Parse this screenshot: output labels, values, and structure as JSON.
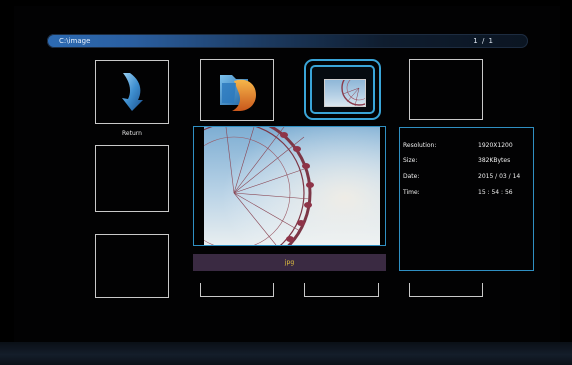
{
  "path_bar": {
    "path": "C:\\image",
    "page_indicator": "1 / 1"
  },
  "tiles": {
    "return_label": "Return",
    "folder_icon": "folder-icon",
    "return_icon": "return-arrow-icon",
    "selected_thumbnail": "ferris-wheel-thumbnail"
  },
  "preview": {
    "image": "ferris-wheel-photo",
    "extension": "jpg"
  },
  "info": {
    "resolution_label": "Resolution:",
    "resolution_value": "1920X1200",
    "size_label": "Size:",
    "size_value": "382KBytes",
    "date_label": "Date:",
    "date_value": "2015 / 03 / 14",
    "time_label": "Time:",
    "time_value": "15 : 54 : 56"
  },
  "colors": {
    "accent": "#3aa5d8",
    "path_bar": "#2d6bb3",
    "extension_text": "#e8c640",
    "extension_bg": "#3a2a42"
  }
}
